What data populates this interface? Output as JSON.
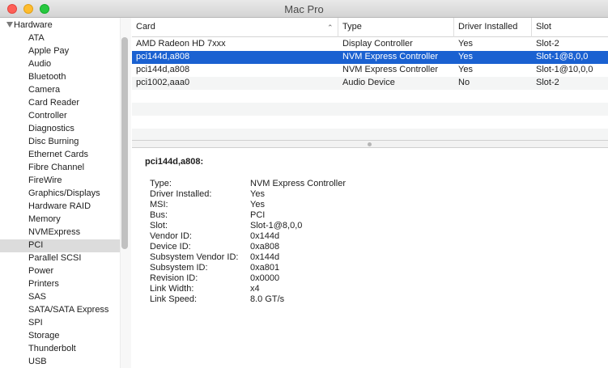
{
  "window": {
    "title": "Mac Pro"
  },
  "sidebar": {
    "section": "Hardware",
    "items": [
      {
        "label": "ATA"
      },
      {
        "label": "Apple Pay"
      },
      {
        "label": "Audio"
      },
      {
        "label": "Bluetooth"
      },
      {
        "label": "Camera"
      },
      {
        "label": "Card Reader"
      },
      {
        "label": "Controller"
      },
      {
        "label": "Diagnostics"
      },
      {
        "label": "Disc Burning"
      },
      {
        "label": "Ethernet Cards"
      },
      {
        "label": "Fibre Channel"
      },
      {
        "label": "FireWire"
      },
      {
        "label": "Graphics/Displays"
      },
      {
        "label": "Hardware RAID"
      },
      {
        "label": "Memory"
      },
      {
        "label": "NVMExpress"
      },
      {
        "label": "PCI"
      },
      {
        "label": "Parallel SCSI"
      },
      {
        "label": "Power"
      },
      {
        "label": "Printers"
      },
      {
        "label": "SAS"
      },
      {
        "label": "SATA/SATA Express"
      },
      {
        "label": "SPI"
      },
      {
        "label": "Storage"
      },
      {
        "label": "Thunderbolt"
      },
      {
        "label": "USB"
      }
    ],
    "selected": "PCI"
  },
  "table": {
    "columns": [
      "Card",
      "Type",
      "Driver Installed",
      "Slot"
    ],
    "rows": [
      [
        "AMD Radeon HD 7xxx",
        "Display Controller",
        "Yes",
        "Slot-2"
      ],
      [
        "pci144d,a808",
        "NVM Express Controller",
        "Yes",
        "Slot-1@8,0,0"
      ],
      [
        "pci144d,a808",
        "NVM Express Controller",
        "Yes",
        "Slot-1@10,0,0"
      ],
      [
        "pci1002,aaa0",
        "Audio Device",
        "No",
        "Slot-2"
      ]
    ],
    "selected_row": 1
  },
  "detail": {
    "title": "pci144d,a808:",
    "fields": [
      {
        "key": "Type:",
        "value": "NVM Express Controller"
      },
      {
        "key": "Driver Installed:",
        "value": "Yes"
      },
      {
        "key": "MSI:",
        "value": "Yes"
      },
      {
        "key": "Bus:",
        "value": "PCI"
      },
      {
        "key": "Slot:",
        "value": "Slot-1@8,0,0"
      },
      {
        "key": "Vendor ID:",
        "value": "0x144d"
      },
      {
        "key": "Device ID:",
        "value": "0xa808"
      },
      {
        "key": "Subsystem Vendor ID:",
        "value": "0x144d"
      },
      {
        "key": "Subsystem ID:",
        "value": "0xa801"
      },
      {
        "key": "Revision ID:",
        "value": "0x0000"
      },
      {
        "key": "Link Width:",
        "value": "x4"
      },
      {
        "key": "Link Speed:",
        "value": "8.0 GT/s"
      }
    ]
  },
  "colors": {
    "selection": "#1a61d1",
    "close": "#fe5f57",
    "minimize": "#febc2e",
    "maximize": "#28c840"
  }
}
